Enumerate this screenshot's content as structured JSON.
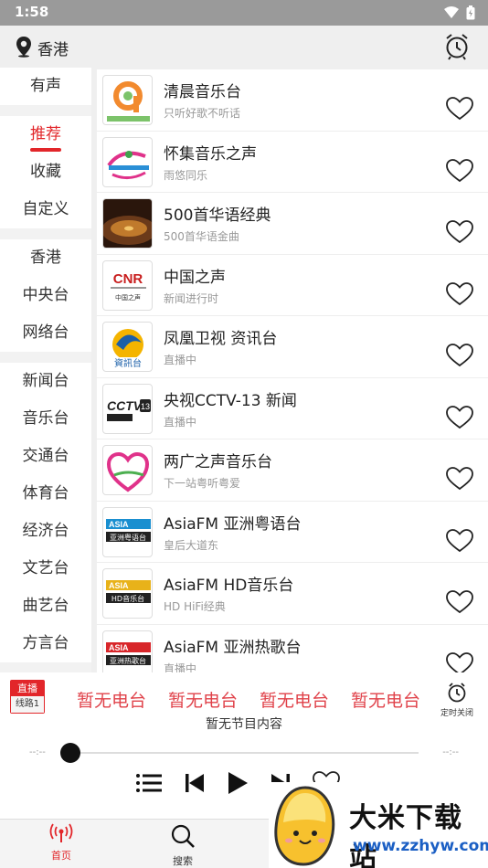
{
  "status": {
    "time": "1:58"
  },
  "header": {
    "location": "香港"
  },
  "sidebar": {
    "groups": [
      [
        "有声"
      ],
      [
        "推荐",
        "收藏",
        "自定义"
      ],
      [
        "香港",
        "中央台",
        "网络台"
      ],
      [
        "新闻台",
        "音乐台",
        "交通台",
        "体育台",
        "经济台",
        "文艺台",
        "曲艺台",
        "方言台"
      ]
    ],
    "active": "推荐"
  },
  "stations": [
    {
      "title": "清晨音乐台",
      "sub": "只听好歌不听话",
      "logo": "qingchen"
    },
    {
      "title": "怀集音乐之声",
      "sub": "雨悠同乐",
      "logo": "huaiji"
    },
    {
      "title": "500首华语经典",
      "sub": "500首华语金曲",
      "logo": "vinyl"
    },
    {
      "title": "中国之声",
      "sub": "新闻进行时",
      "logo": "cnr"
    },
    {
      "title": "凤凰卫视 资讯台",
      "sub": "直播中",
      "logo": "phoenix"
    },
    {
      "title": "央视CCTV-13 新闻",
      "sub": "直播中",
      "logo": "cctv"
    },
    {
      "title": "两广之声音乐台",
      "sub": "下一站粤听粤爱",
      "logo": "heart"
    },
    {
      "title": "AsiaFM 亚洲粤语台",
      "sub": "皇后大道东",
      "logo": "asia1"
    },
    {
      "title": "AsiaFM HD音乐台",
      "sub": "HD HiFi经典",
      "logo": "asia2"
    },
    {
      "title": "AsiaFM 亚洲热歌台",
      "sub": "直播中",
      "logo": "asia3"
    }
  ],
  "player": {
    "badge_top": "直播",
    "badge_bottom": "线路1",
    "marquee": [
      "暂无电台",
      "暂无电台",
      "暂无电台",
      "暂无电台"
    ],
    "timer_label": "定时关闭",
    "program": "暂无节目内容",
    "time_left": "--:--",
    "time_right": "--:--"
  },
  "tabs": {
    "home": "首页",
    "search": "搜索"
  },
  "watermark": {
    "name": "大米下载站",
    "url": "www.zzhyw.com"
  },
  "colors": {
    "accent": "#e2262a",
    "marquee": "#e0424a"
  }
}
